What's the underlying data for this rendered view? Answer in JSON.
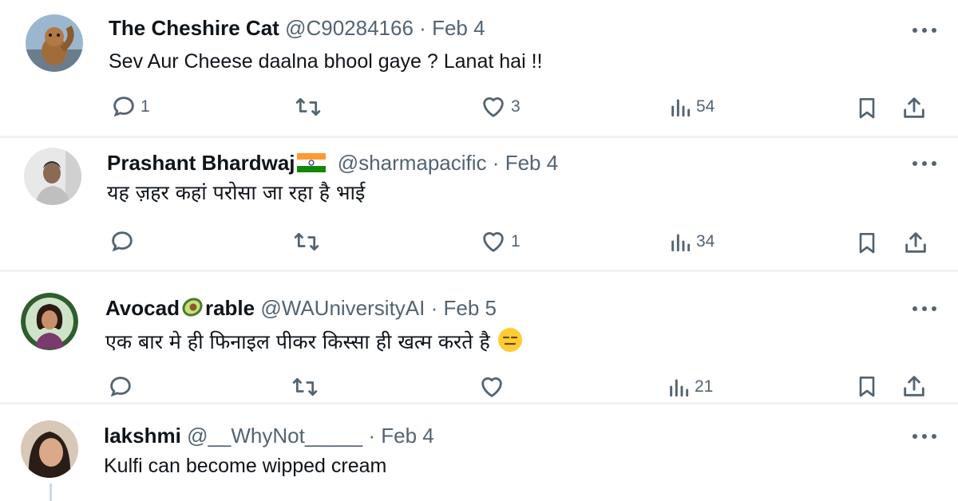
{
  "replies": [
    {
      "name": "The Cheshire Cat",
      "handle": "@C90284166",
      "separator": "·",
      "date": "Feb 4",
      "text": "Sev Aur Cheese daalna bhool gaye ? Lanat hai !!",
      "stats": {
        "replies": "1",
        "retweets": "",
        "likes": "3",
        "views": "54"
      },
      "avatar": "squirrel-photo"
    },
    {
      "name": "Prashant Bhardwaj",
      "name_suffix_flag": "india-flag",
      "handle": "@sharmapacific",
      "separator": "·",
      "date": "Feb 4",
      "text": "यह ज़हर कहां परोसा जा रहा है भाई",
      "stats": {
        "replies": "",
        "retweets": "",
        "likes": "1",
        "views": "34"
      },
      "avatar": "man-portrait"
    },
    {
      "name_part1": "Avocad",
      "name_emoji": "avocado",
      "name_part2": "rable",
      "handle": "@WAUniversityAI",
      "separator": "·",
      "date": "Feb 5",
      "text": "एक बार मे ही फिनाइल पीकर किस्सा ही खत्म करते है",
      "trailing_emoji": "expressionless-face",
      "stats": {
        "replies": "",
        "retweets": "",
        "likes": "",
        "views": "21"
      },
      "avatar": "woman-portrait"
    },
    {
      "name": "lakshmi",
      "handle": "@__WhyNot_____",
      "separator": "·",
      "date": "Feb 4",
      "text": "Kulfi can become wipped cream",
      "avatar": "woman-portrait-2"
    }
  ],
  "colors": {
    "text": "#0f1419",
    "muted": "#536471",
    "divider": "#eff3f4",
    "thread_line": "#cfd9de"
  }
}
